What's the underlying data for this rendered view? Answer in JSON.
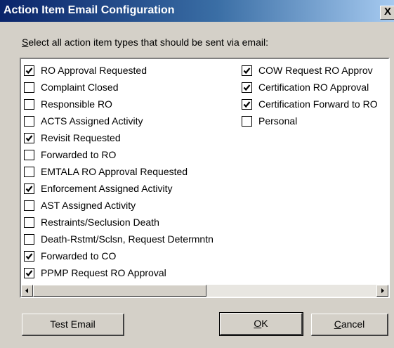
{
  "window": {
    "title": "Action Item Email Configuration",
    "close_glyph": "X"
  },
  "instruction": {
    "accel": "S",
    "rest": "elect all action item types that should be sent via email:"
  },
  "items_col1": [
    {
      "label": "RO Approval Requested",
      "checked": true
    },
    {
      "label": "Complaint Closed",
      "checked": false
    },
    {
      "label": "Responsible RO",
      "checked": false
    },
    {
      "label": "ACTS Assigned Activity",
      "checked": false
    },
    {
      "label": "Revisit Requested",
      "checked": true
    },
    {
      "label": "Forwarded to RO",
      "checked": false
    },
    {
      "label": "EMTALA RO Approval Requested",
      "checked": false
    },
    {
      "label": "Enforcement Assigned Activity",
      "checked": true
    },
    {
      "label": "AST Assigned Activity",
      "checked": false
    },
    {
      "label": "Restraints/Seclusion Death",
      "checked": false
    },
    {
      "label": "Death-Rstmt/Sclsn, Request Determntn",
      "checked": false
    },
    {
      "label": "Forwarded to CO",
      "checked": true
    },
    {
      "label": "PPMP Request RO Approval",
      "checked": true
    }
  ],
  "items_col2": [
    {
      "label": "COW Request RO Approv",
      "checked": true
    },
    {
      "label": "Certification RO Approval",
      "checked": true
    },
    {
      "label": "Certification Forward to RO",
      "checked": true
    },
    {
      "label": "Personal",
      "checked": false
    }
  ],
  "buttons": {
    "test_email": "Test Email",
    "ok_accel": "O",
    "ok_rest": "K",
    "cancel_accel": "C",
    "cancel_rest": "ancel"
  }
}
